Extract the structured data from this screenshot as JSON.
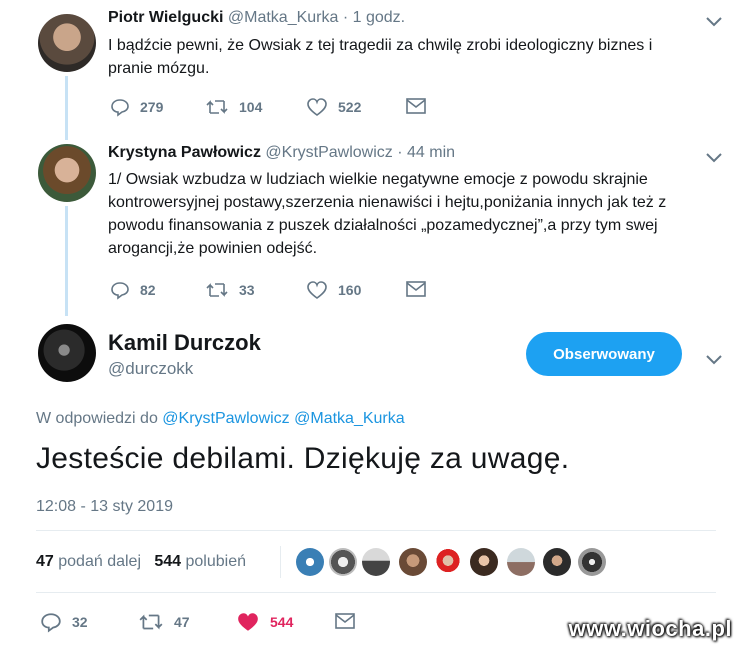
{
  "tweets": [
    {
      "name": "Piotr Wielgucki",
      "handle": "@Matka_Kurka",
      "time": "· 1 godz.",
      "text_line1": "I bądźcie pewni, że Owsiak z tej tragedii za chwilę zrobi ideologiczny biznes i",
      "text_line2": "pranie mózgu.",
      "replies": "279",
      "retweets": "104",
      "likes": "522"
    },
    {
      "name": "Krystyna Pawłowicz",
      "handle": "@KrystPawlowicz",
      "time": "· 44 min",
      "text_line1": "1/ Owsiak wzbudza w ludziach wielkie negatywne emocje z powodu  skrajnie",
      "text_line2": "kontrowersyjnej postawy,szerzenia nienawiści i hejtu,poniżania innych jak też z",
      "text_line3": "powodu finansowania z puszek działalności „pozamedycznej”,a przy tym swej",
      "text_line4": "arogancji,że powinien odejść.",
      "replies": "82",
      "retweets": "33",
      "likes": "160"
    }
  ],
  "main": {
    "name": "Kamil Durczok",
    "handle": "@durczokk",
    "follow_label": "Obserwowany",
    "reply_prefix": "W odpowiedzi do",
    "reply_to_1": "@KrystPawlowicz",
    "reply_to_2": "@Matka_Kurka",
    "text": "Jesteście debilami. Dziękuję za uwagę.",
    "timestamp": "12:08 - 13 sty 2019",
    "retweet_count": "47",
    "retweet_label": "podań dalej",
    "like_count": "544",
    "like_label": "polubień",
    "replies": "32",
    "retweets": "47",
    "likes": "544"
  },
  "watermark": "www.wiocha.pl",
  "colors": {
    "accent": "#1da1f2",
    "like_red": "#e0245e",
    "muted": "#657786",
    "thread_line": "#c7e2f5"
  }
}
